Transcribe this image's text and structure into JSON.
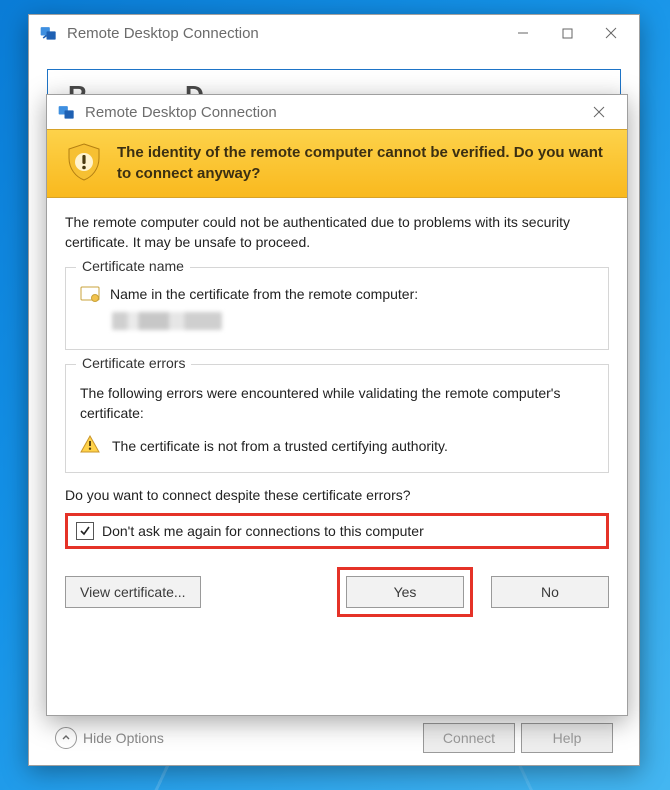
{
  "parent_window": {
    "title": "Remote Desktop Connection",
    "masked_heading": "R————  D——l—",
    "hide_options": "Hide Options",
    "connect": "Connect",
    "help": "Help"
  },
  "dialog": {
    "title": "Remote Desktop Connection",
    "banner": "The identity of the remote computer cannot be verified. Do you want to connect anyway?",
    "lead": "The remote computer could not be authenticated due to problems with its security certificate. It may be unsafe to proceed.",
    "cert_name_legend": "Certificate name",
    "cert_name_label": "Name in the certificate from the remote computer:",
    "cert_errors_legend": "Certificate errors",
    "cert_errors_desc": "The following errors were encountered while validating the remote computer's certificate:",
    "cert_error_1": "The certificate is not from a trusted certifying authority.",
    "question": "Do you want to connect despite these certificate errors?",
    "checkbox_label": "Don't ask me again for connections to this computer",
    "checkbox_checked": true,
    "view_cert": "View certificate...",
    "yes": "Yes",
    "no": "No"
  }
}
